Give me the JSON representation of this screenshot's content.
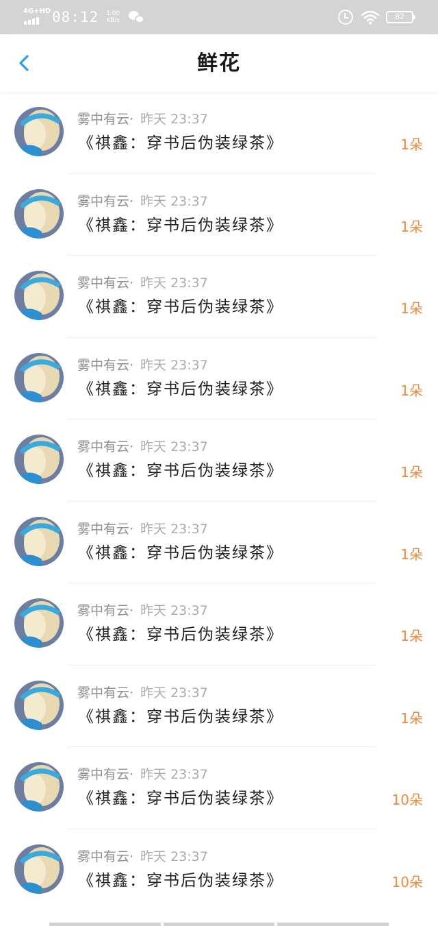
{
  "status_bar": {
    "network": "4G+HD",
    "time": "08:12",
    "speed_value": "1.00",
    "speed_unit": "KB/s",
    "battery": "82"
  },
  "header": {
    "title": "鲜花"
  },
  "colors": {
    "accent": "#2b9ef0",
    "flower_count": "#ef8a3c",
    "status_bar_bg": "#d4d4d4"
  },
  "items": [
    {
      "user": "雾中有云·",
      "time": "昨天 23:37",
      "book": "《祺鑫：穿书后伪装绿茶》",
      "count": "1朵"
    },
    {
      "user": "雾中有云·",
      "time": "昨天 23:37",
      "book": "《祺鑫：穿书后伪装绿茶》",
      "count": "1朵"
    },
    {
      "user": "雾中有云·",
      "time": "昨天 23:37",
      "book": "《祺鑫：穿书后伪装绿茶》",
      "count": "1朵"
    },
    {
      "user": "雾中有云·",
      "time": "昨天 23:37",
      "book": "《祺鑫：穿书后伪装绿茶》",
      "count": "1朵"
    },
    {
      "user": "雾中有云·",
      "time": "昨天 23:37",
      "book": "《祺鑫：穿书后伪装绿茶》",
      "count": "1朵"
    },
    {
      "user": "雾中有云·",
      "time": "昨天 23:37",
      "book": "《祺鑫：穿书后伪装绿茶》",
      "count": "1朵"
    },
    {
      "user": "雾中有云·",
      "time": "昨天 23:37",
      "book": "《祺鑫：穿书后伪装绿茶》",
      "count": "1朵"
    },
    {
      "user": "雾中有云·",
      "time": "昨天 23:37",
      "book": "《祺鑫：穿书后伪装绿茶》",
      "count": "1朵"
    },
    {
      "user": "雾中有云·",
      "time": "昨天 23:37",
      "book": "《祺鑫：穿书后伪装绿茶》",
      "count": "10朵"
    },
    {
      "user": "雾中有云·",
      "time": "昨天 23:37",
      "book": "《祺鑫：穿书后伪装绿茶》",
      "count": "10朵"
    }
  ]
}
